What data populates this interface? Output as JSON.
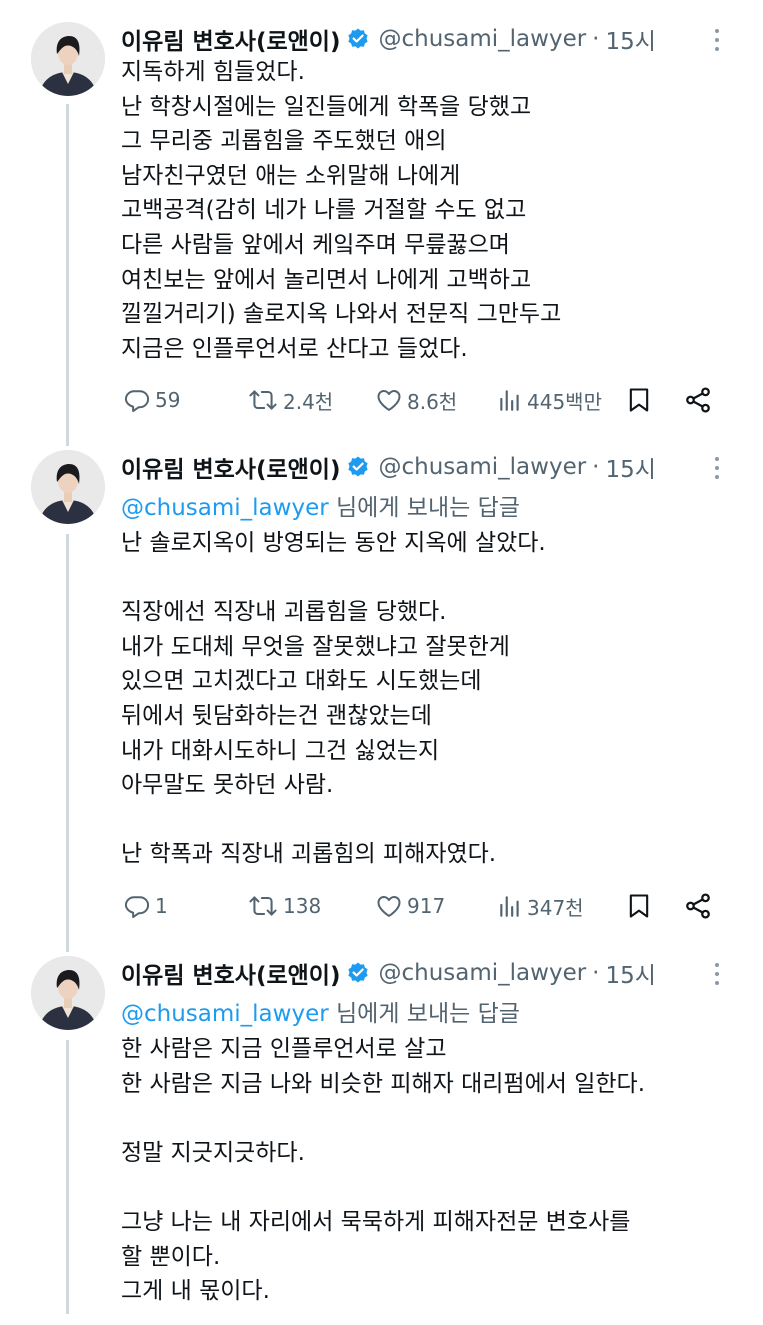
{
  "author": {
    "name": "이유림 변호사(로앤이)",
    "handle": "@chusami_lawyer",
    "separator": "·",
    "avatar_icon": "profile-photo-woman-dark-suit"
  },
  "colors": {
    "text": "#0f1419",
    "muted": "#536471",
    "link": "#1d9bf0",
    "verified": "#1d9bf0",
    "thread_line": "#cfd9de"
  },
  "tweets": [
    {
      "time": "15시",
      "reply_to": null,
      "text": "지독하게 힘들었다.\n난 학창시절에는 일진들에게 학폭을 당했고\n그 무리중 괴롭힘을 주도했던 애의\n남자친구였던 애는 소위말해 나에게\n고백공격(감히 네가 나를 거절할 수도 없고\n다른 사람들 앞에서 케잌주며 무릎꿇으며\n여친보는 앞에서 놀리면서 나에게 고백하고\n낄낄거리기) 솔로지옥 나와서 전문직 그만두고\n지금은 인플루언서로 산다고 들었다.",
      "stats": {
        "replies": "59",
        "retweets": "2.4천",
        "likes": "8.6천",
        "views": "445백만"
      }
    },
    {
      "time": "15시",
      "reply_to": {
        "mention": "@chusami_lawyer",
        "suffix": " 님에게 보내는 답글"
      },
      "text": "난 솔로지옥이 방영되는 동안 지옥에 살았다.\n\n직장에선 직장내 괴롭힘을 당했다.\n내가 도대체 무엇을 잘못했냐고 잘못한게\n있으면 고치겠다고 대화도 시도했는데\n뒤에서 뒷담화하는건 괜찮았는데\n내가 대화시도하니 그건 싫었는지\n아무말도 못하던 사람.\n\n난 학폭과 직장내 괴롭힘의 피해자였다.",
      "stats": {
        "replies": "1",
        "retweets": "138",
        "likes": "917",
        "views": "347천"
      }
    },
    {
      "time": "15시",
      "reply_to": {
        "mention": "@chusami_lawyer",
        "suffix": " 님에게 보내는 답글"
      },
      "text": "한 사람은 지금 인플루언서로 살고\n한 사람은 지금 나와 비슷한 피해자 대리펌에서 일한다.\n\n정말 지긋지긋하다.\n\n그냥 나는 내 자리에서 묵묵하게 피해자전문 변호사를\n할 뿐이다.\n그게 내 몫이다."
    }
  ]
}
